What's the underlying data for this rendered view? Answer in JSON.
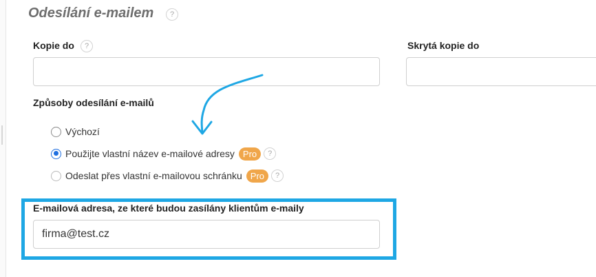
{
  "section": {
    "title": "Odesílání e-mailem",
    "help_glyph": "?"
  },
  "fields": {
    "copy_to": {
      "label": "Kopie do",
      "value": ""
    },
    "bcc": {
      "label": "Skrytá kopie do",
      "value": ""
    }
  },
  "sending_methods": {
    "label": "Způsoby odesílání e-mailů",
    "options": [
      {
        "label": "Výchozí",
        "selected": false
      },
      {
        "label": "Použijte vlastní název e-mailové adresy",
        "badge": "Pro",
        "selected": true
      },
      {
        "label": "Odeslat přes vlastní e-mailovou schránku",
        "badge": "Pro",
        "selected": false
      }
    ]
  },
  "sender_email": {
    "label": "E-mailová adresa, ze které budou zasílány klientům e-maily",
    "value": "firma@test.cz"
  },
  "colors": {
    "accent": "#1f6fe0",
    "highlight": "#1ea7e4",
    "badge": "#f0a64a"
  },
  "icons": [
    "help-icon",
    "radio-icon",
    "arrow-annotation-icon"
  ]
}
